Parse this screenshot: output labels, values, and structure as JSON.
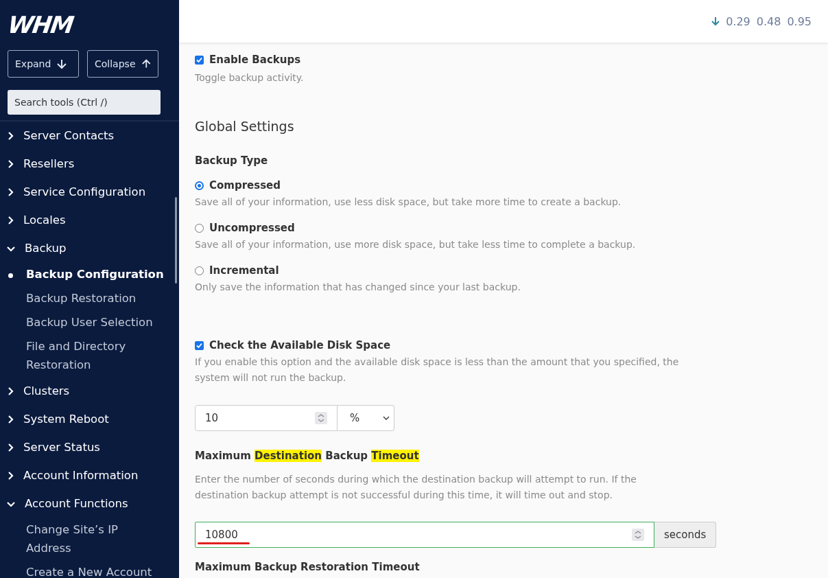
{
  "sidebar": {
    "logo": "WHM",
    "buttons": [
      {
        "label": "Expand",
        "kind": "expand"
      },
      {
        "label": "Collapse",
        "kind": "collapse"
      }
    ],
    "search": {
      "placeholder": "Search tools (Ctrl /)"
    },
    "items": [
      {
        "label": "Server Contacts",
        "expanded": false,
        "selected": false
      },
      {
        "label": "Resellers",
        "expanded": false,
        "selected": false
      },
      {
        "label": "Service Configuration",
        "expanded": false,
        "selected": false
      },
      {
        "label": "Locales",
        "expanded": false,
        "selected": false
      },
      {
        "label": "Backup",
        "expanded": true,
        "selected": false,
        "children": [
          {
            "label": "Backup Configuration",
            "selected": true
          },
          {
            "label": "Backup Restoration",
            "selected": false
          },
          {
            "label": "Backup User Selection",
            "selected": false
          },
          {
            "label": "File and Directory Restoration",
            "selected": false
          }
        ]
      },
      {
        "label": "Clusters",
        "expanded": false,
        "selected": false
      },
      {
        "label": "System Reboot",
        "expanded": false,
        "selected": false
      },
      {
        "label": "Server Status",
        "expanded": false,
        "selected": false
      },
      {
        "label": "Account Information",
        "expanded": false,
        "selected": false
      },
      {
        "label": "Account Functions",
        "expanded": true,
        "selected": false,
        "children": [
          {
            "label": "Change Site’s IP Address",
            "selected": false
          },
          {
            "label": "Create a New Account",
            "selected": false
          }
        ]
      }
    ]
  },
  "header": {
    "load_averages": [
      "0.29",
      "0.48",
      "0.95"
    ]
  },
  "content": {
    "enable_backups": {
      "label": "Enable Backups",
      "checked": true,
      "description": "Toggle backup activity."
    },
    "global_settings": {
      "title": "Global Settings"
    },
    "backup_type": {
      "label": "Backup Type",
      "options": [
        {
          "label": "Compressed",
          "selected": true,
          "description": "Save all of your information, use less disk space, but take more time to create a backup."
        },
        {
          "label": "Uncompressed",
          "selected": false,
          "description": "Save all of your information, use more disk space, but take less time to complete a backup."
        },
        {
          "label": "Incremental",
          "selected": false,
          "description": "Only save the information that has changed since your last backup."
        }
      ]
    },
    "disk_space_check": {
      "label": "Check the Available Disk Space",
      "checked": true,
      "description": "If you enable this option and the available disk space is less than the amount that you specified, the system will not run the backup.",
      "value": "10",
      "unit": "%"
    },
    "destination_timeout": {
      "title_parts": [
        {
          "text": "Maximum",
          "highlighted": false
        },
        {
          "text": "Destination",
          "highlighted": true
        },
        {
          "text": "Backup",
          "highlighted": false
        },
        {
          "text": "Timeout",
          "highlighted": true
        }
      ],
      "description": "Enter the number of seconds during which the destination backup will attempt to run. If the destination backup attempt is not successful during this time, it will time out and stop.",
      "value": "10800",
      "unit": "seconds",
      "underlined": true
    },
    "restoration_timeout": {
      "title": "Maximum Backup Restoration Timeout"
    }
  }
}
